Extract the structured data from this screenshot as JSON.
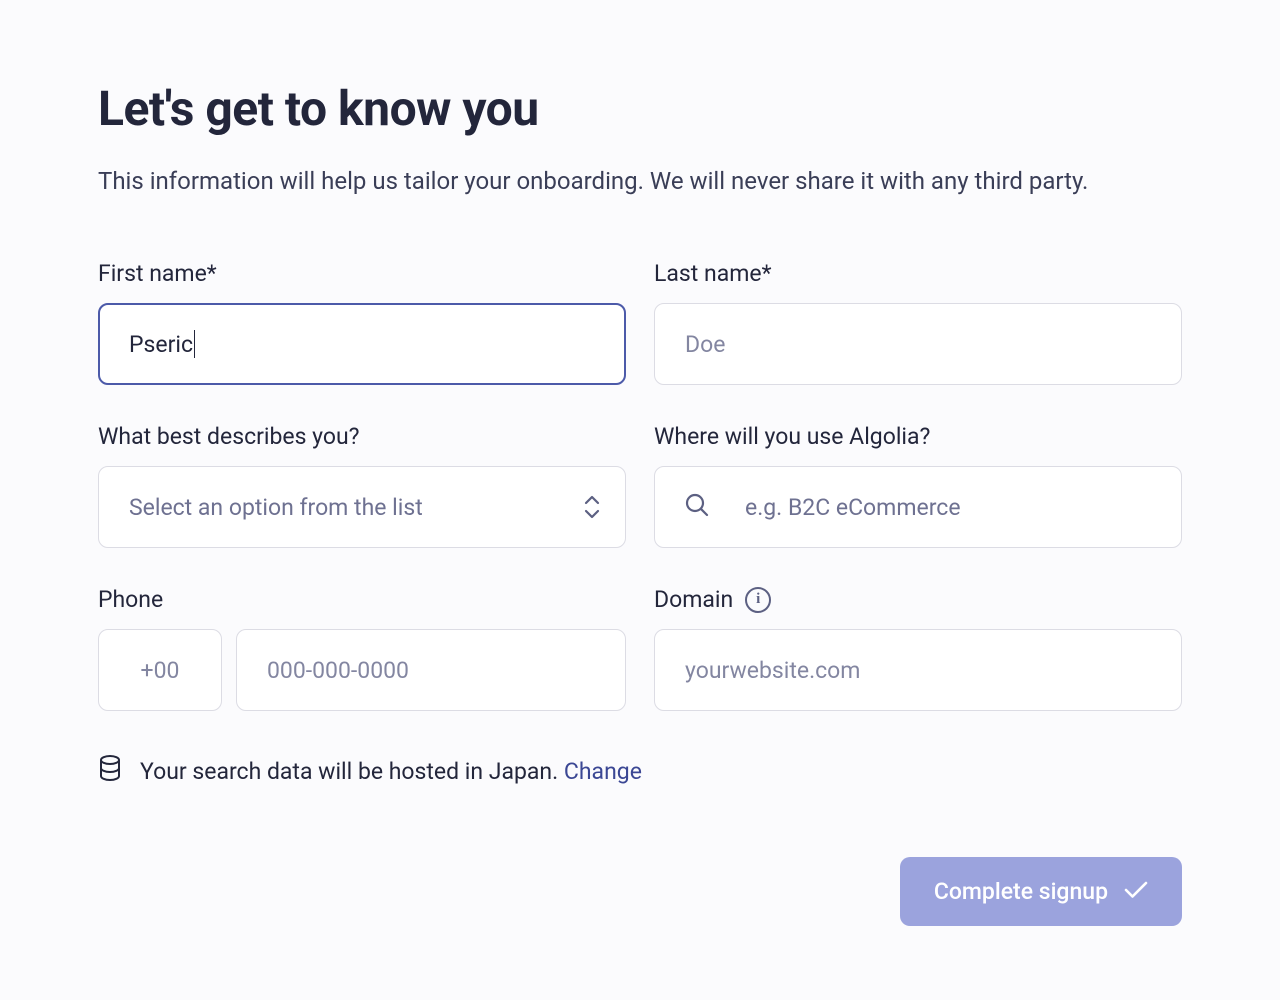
{
  "header": {
    "title": "Let's get to know you",
    "subtitle": "This information will help us tailor your onboarding. We will never share it with any third party."
  },
  "form": {
    "first_name": {
      "label": "First name*",
      "value": "Pseric"
    },
    "last_name": {
      "label": "Last name*",
      "placeholder": "Doe",
      "value": ""
    },
    "describes_you": {
      "label": "What best describes you?",
      "placeholder": "Select an option from the list"
    },
    "use_where": {
      "label": "Where will you use Algolia?",
      "placeholder": "e.g. B2C eCommerce"
    },
    "phone": {
      "label": "Phone",
      "code_placeholder": "+00",
      "number_placeholder": "000-000-0000"
    },
    "domain": {
      "label": "Domain",
      "placeholder": "yourwebsite.com"
    }
  },
  "hosting": {
    "text": "Your search data will be hosted in Japan.",
    "change_label": "Change"
  },
  "actions": {
    "complete_label": "Complete signup"
  },
  "colors": {
    "accent": "#9ba3dd",
    "focus_border": "#4c5aa9",
    "text": "#23263b",
    "muted": "#6e7191"
  }
}
